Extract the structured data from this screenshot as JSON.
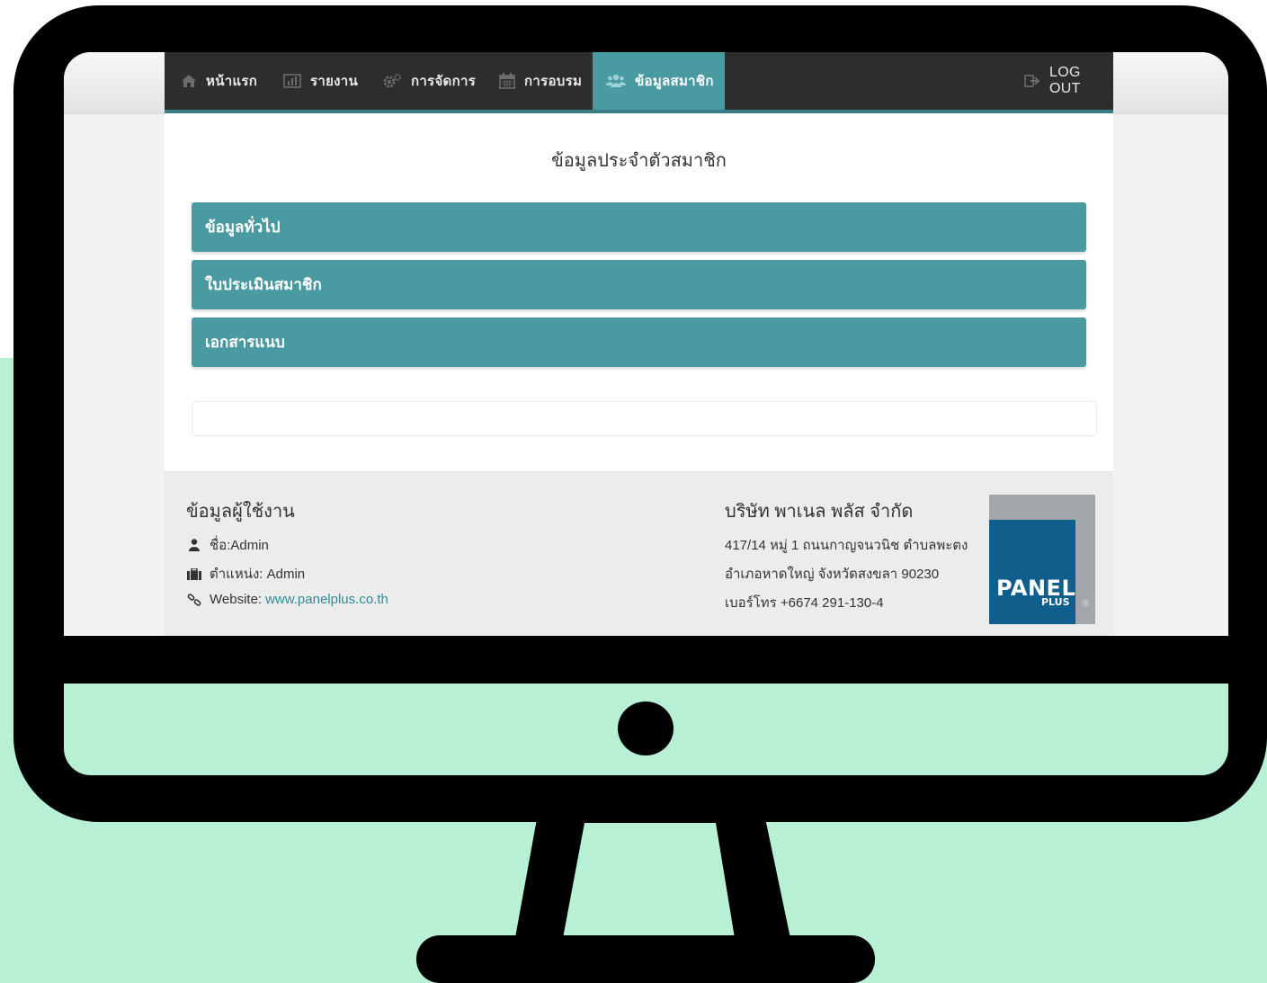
{
  "nav": {
    "items": [
      {
        "label": "หน้าแรก",
        "icon": "home-icon"
      },
      {
        "label": "รายงาน",
        "icon": "bar-chart-icon"
      },
      {
        "label": "การจัดการ",
        "icon": "gears-icon"
      },
      {
        "label": "การอบรม",
        "icon": "calendar-icon"
      },
      {
        "label": "ข้อมูลสมาชิก",
        "icon": "users-icon",
        "active": true
      }
    ],
    "logout_label": "LOG OUT",
    "logout_icon": "logout-icon"
  },
  "main": {
    "title": "ข้อมูลประจำตัวสมาชิก",
    "sections": [
      {
        "label": "ข้อมูลทั่วไป"
      },
      {
        "label": "ใบประเมินสมาชิก"
      },
      {
        "label": "เอกสารแนบ"
      }
    ]
  },
  "footer": {
    "user": {
      "heading": "ข้อมูลผู้ใช้งาน",
      "name": "ชื่อ:Admin",
      "position": "ตำแหน่ง: Admin",
      "website_label": "Website:",
      "website_url": "www.panelplus.co.th"
    },
    "company": {
      "name": "บริษัท พาเนล พลัส จำกัด",
      "address_line1": "417/14 หมู่ 1 ถนนกาญจนวนิช ตำบลพะตง",
      "address_line2": "อำเภอหาดใหญ่ จังหวัดสงขลา 90230",
      "phone": "เบอร์โทร +6674 291-130-4"
    },
    "logo": {
      "text": "PANEL",
      "sub": "PLUS",
      "reg": "®"
    }
  },
  "colors": {
    "navbar": "#2d2d2d",
    "accent": "#4a9aa1",
    "link": "#2f8b94",
    "logo_blue": "#0f5e8b",
    "background_mint": "#b8f0d6"
  }
}
